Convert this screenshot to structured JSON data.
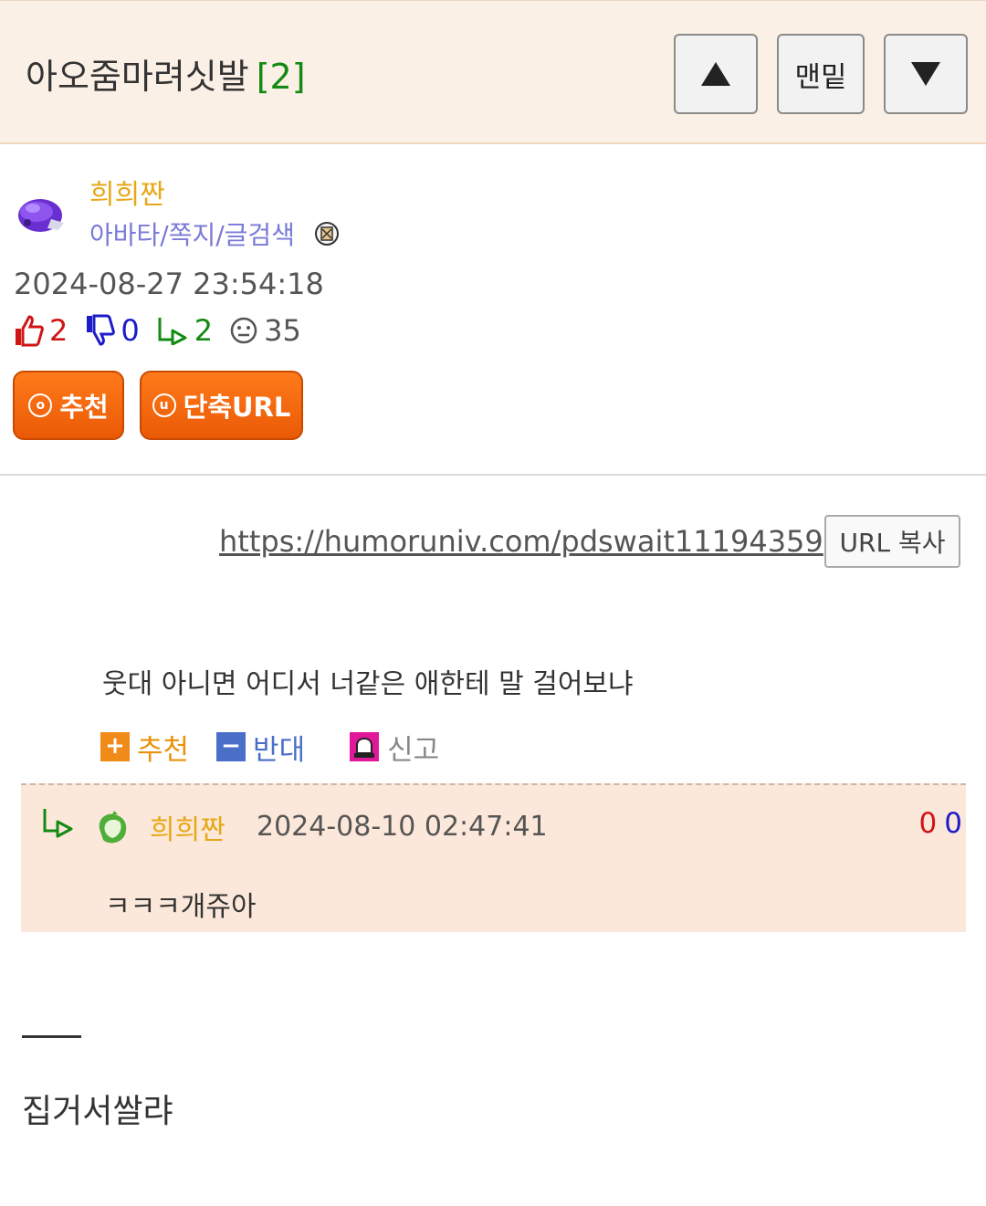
{
  "header": {
    "title": "아오줌마려싯발",
    "comment_count": "[2]",
    "bottom_label": "맨밑",
    "up_icon": "triangle-up-icon",
    "down_icon": "triangle-down-icon"
  },
  "author": {
    "name": "희희짠",
    "links": "아바타/쪽지/글검색",
    "avatar_icon": "purple-creature-avatar",
    "badge_icon": "member-badge-icon"
  },
  "post": {
    "date": "2024-08-27 23:54:18",
    "stats": {
      "upvotes": "2",
      "downvotes": "0",
      "replies": "2",
      "views": "35"
    },
    "recommend_btn": "추천",
    "recommend_icon_char": "o",
    "shorturl_btn": "단축URL",
    "shorturl_icon_char": "u"
  },
  "url_section": {
    "url": "https://humoruniv.com/pdswait11194359",
    "copy_label": "URL 복사"
  },
  "comment": {
    "text": "웃대 아니면 어디서 너같은 애한테 말 걸어보냐",
    "actions": {
      "recommend": "추천",
      "oppose": "반대",
      "report": "신고",
      "plus_sign": "+",
      "minus_sign": "−"
    }
  },
  "reply": {
    "name": "희희짠",
    "date": "2024-08-10 02:47:41",
    "up": "0",
    "down": "0",
    "text": "ㅋㅋㅋ개쥬아"
  },
  "body_text": "집거서쌀랴",
  "colors": {
    "header_bg": "#fbf0e5",
    "accent_orange": "#ea5a06",
    "author_yellow": "#e6a817",
    "link_purple": "#7a7ad8",
    "reply_bg": "#fce8da",
    "up_red": "#d01515",
    "down_blue": "#1c1cc8",
    "reply_green": "#138a13"
  }
}
